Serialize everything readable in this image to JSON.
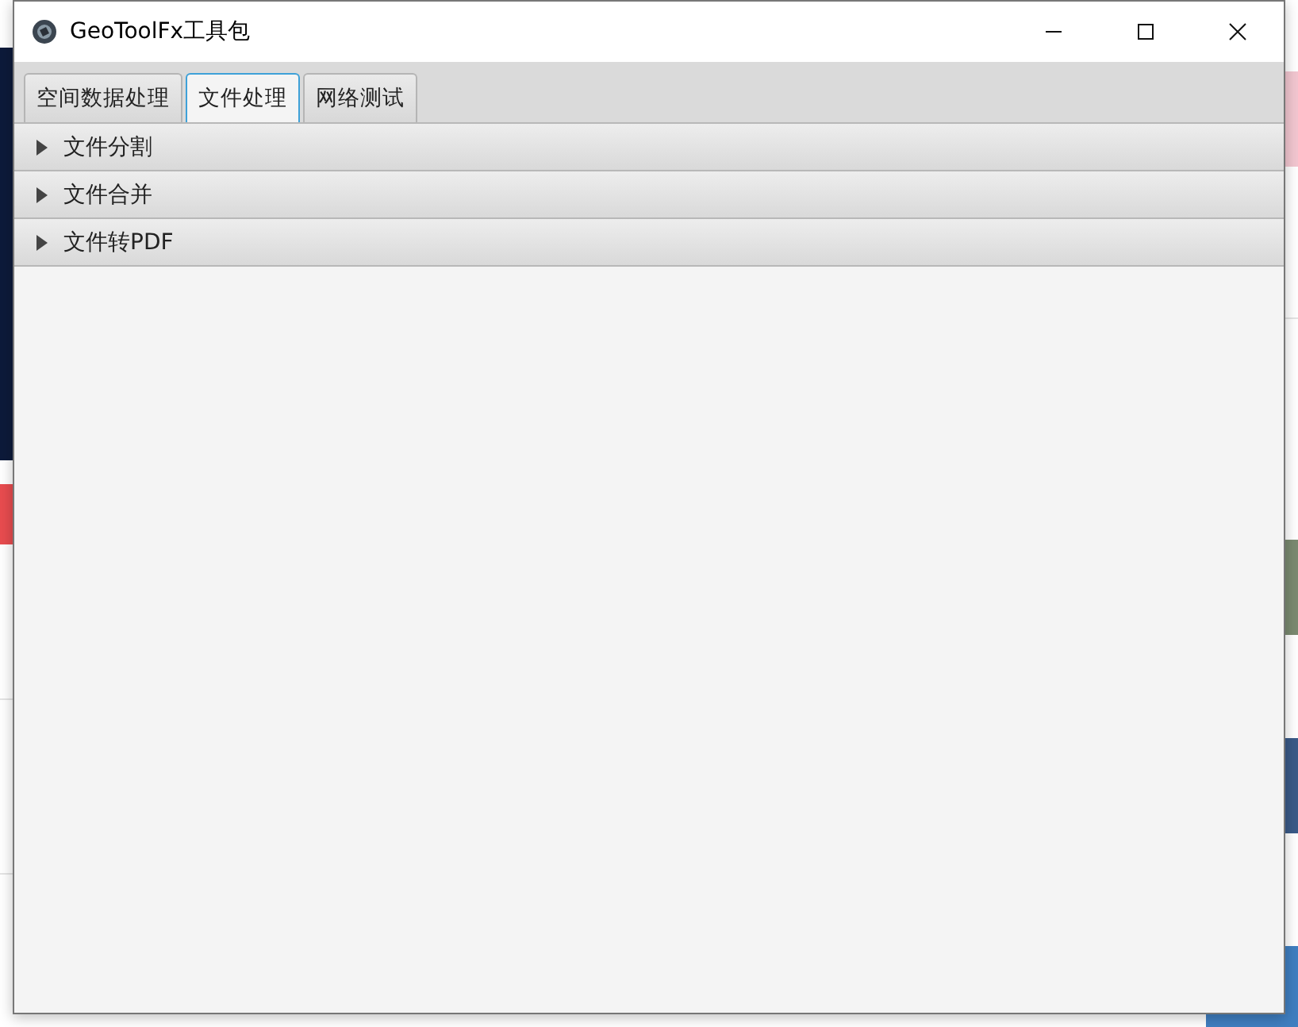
{
  "window": {
    "title": "GeoToolFx工具包"
  },
  "tabs": [
    {
      "label": "空间数据处理",
      "selected": false
    },
    {
      "label": "文件处理",
      "selected": true
    },
    {
      "label": "网络测试",
      "selected": false
    }
  ],
  "panes": [
    {
      "title": "文件分割",
      "expanded": false
    },
    {
      "title": "文件合并",
      "expanded": false
    },
    {
      "title": "文件转PDF",
      "expanded": false
    }
  ]
}
